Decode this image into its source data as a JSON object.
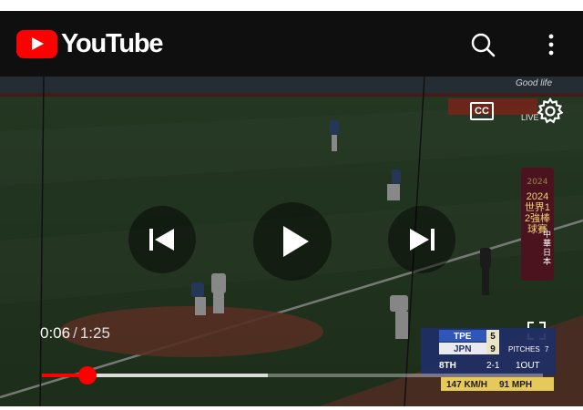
{
  "app": {
    "brand": "YouTube"
  },
  "player": {
    "cc_label": "CC",
    "current_time": "0:06",
    "separator": "/",
    "duration": "1:25",
    "progress_played": 0.09,
    "progress_buffered": 0.45
  },
  "overlay": {
    "channel_badge": "LIVE",
    "corner_text": "Good life",
    "event_banner": "2024 世界12強棒球賽",
    "teams_banner": "中華 日本"
  },
  "scoreboard": {
    "rows": [
      {
        "team": "TPE",
        "score": "5"
      },
      {
        "team": "JPN",
        "score": "9",
        "extra_label": "PITCHES",
        "extra_value": "7"
      }
    ],
    "inning": "8TH",
    "count": "2-1",
    "outs": "1OUT",
    "speed_kmh": "147",
    "speed_kmh_unit": "KM/H",
    "speed_mph": "91",
    "speed_mph_unit": "MPH"
  },
  "colors": {
    "accent": "#ff0000",
    "appbar": "#0f0f0f"
  }
}
